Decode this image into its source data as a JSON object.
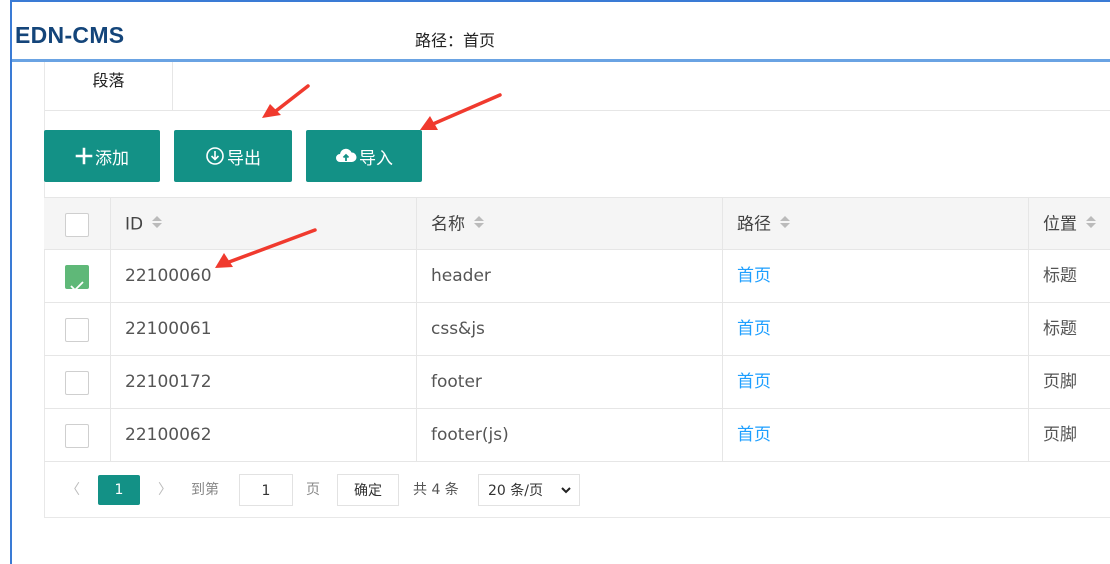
{
  "header": {
    "brand": "EDN-CMS",
    "breadcrumb": "路径：首页"
  },
  "tabs": [
    {
      "label": "段落"
    }
  ],
  "toolbar": {
    "add_label": "添加",
    "add_icon": "plus-icon",
    "export_label": "导出",
    "export_icon": "download-circle-icon",
    "import_label": "导入",
    "import_icon": "cloud-upload-icon"
  },
  "table": {
    "columns": [
      "ID",
      "名称",
      "路径",
      "位置"
    ],
    "rows": [
      {
        "checked": true,
        "id": "22100060",
        "name": "header",
        "path": "首页",
        "position": "标题"
      },
      {
        "checked": false,
        "id": "22100061",
        "name": "css&js",
        "path": "首页",
        "position": "标题"
      },
      {
        "checked": false,
        "id": "22100172",
        "name": "footer",
        "path": "首页",
        "position": "页脚"
      },
      {
        "checked": false,
        "id": "22100062",
        "name": "footer(js)",
        "path": "首页",
        "position": "页脚"
      }
    ]
  },
  "pagination": {
    "prev": "〈",
    "current_page": "1",
    "next": "〉",
    "goto_label": "到第",
    "goto_value": "1",
    "page_unit": "页",
    "confirm": "确定",
    "total": "共 4 条",
    "page_size": "20 条/页"
  },
  "colors": {
    "primary": "#139186",
    "link": "#1e9fff",
    "checked": "#5fb878",
    "brand": "#14457a",
    "annotation_arrow": "#f03a2e"
  }
}
